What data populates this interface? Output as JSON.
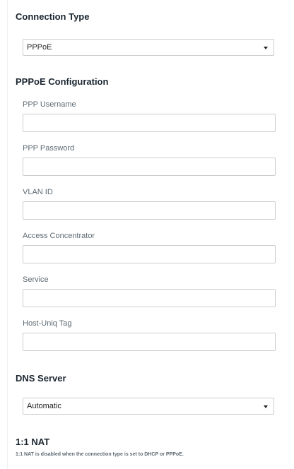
{
  "connection_type": {
    "title": "Connection Type",
    "selected": "PPPoE"
  },
  "pppoe": {
    "title": "PPPoE Configuration",
    "fields": {
      "username": {
        "label": "PPP Username",
        "value": ""
      },
      "password": {
        "label": "PPP Password",
        "value": ""
      },
      "vlan_id": {
        "label": "VLAN ID",
        "value": ""
      },
      "access_concentrator": {
        "label": "Access Concentrator",
        "value": ""
      },
      "service": {
        "label": "Service",
        "value": ""
      },
      "host_uniq": {
        "label": "Host-Uniq Tag",
        "value": ""
      }
    }
  },
  "dns": {
    "title": "DNS Server",
    "selected": "Automatic"
  },
  "nat": {
    "title": "1:1 NAT",
    "note": "1:1 NAT is disabled when the connection type is set to DHCP or PPPoE."
  }
}
